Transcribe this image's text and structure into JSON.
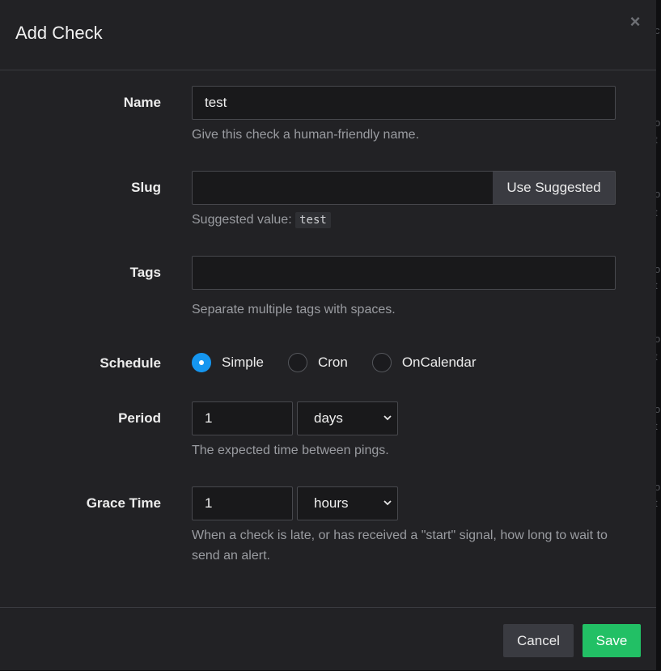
{
  "modal": {
    "title": "Add Check",
    "close_icon": "times-icon"
  },
  "form": {
    "name": {
      "label": "Name",
      "value": "test",
      "help": "Give this check a human-friendly name."
    },
    "slug": {
      "label": "Slug",
      "value": "",
      "button": "Use Suggested",
      "help_prefix": "Suggested value:",
      "suggested": "test"
    },
    "tags": {
      "label": "Tags",
      "value": "",
      "help": "Separate multiple tags with spaces."
    },
    "schedule": {
      "label": "Schedule",
      "options": [
        "Simple",
        "Cron",
        "OnCalendar"
      ],
      "selected": "Simple"
    },
    "period": {
      "label": "Period",
      "value": "1",
      "unit": "days",
      "help": "The expected time between pings."
    },
    "grace": {
      "label": "Grace Time",
      "value": "1",
      "unit": "hours",
      "help": "When a check is late, or has received a \"start\" signal, how long to wait to send an alert."
    }
  },
  "footer": {
    "cancel": "Cancel",
    "save": "Save"
  },
  "colors": {
    "accent": "#1596f0",
    "save": "#22c065",
    "modal_bg": "#222225"
  }
}
